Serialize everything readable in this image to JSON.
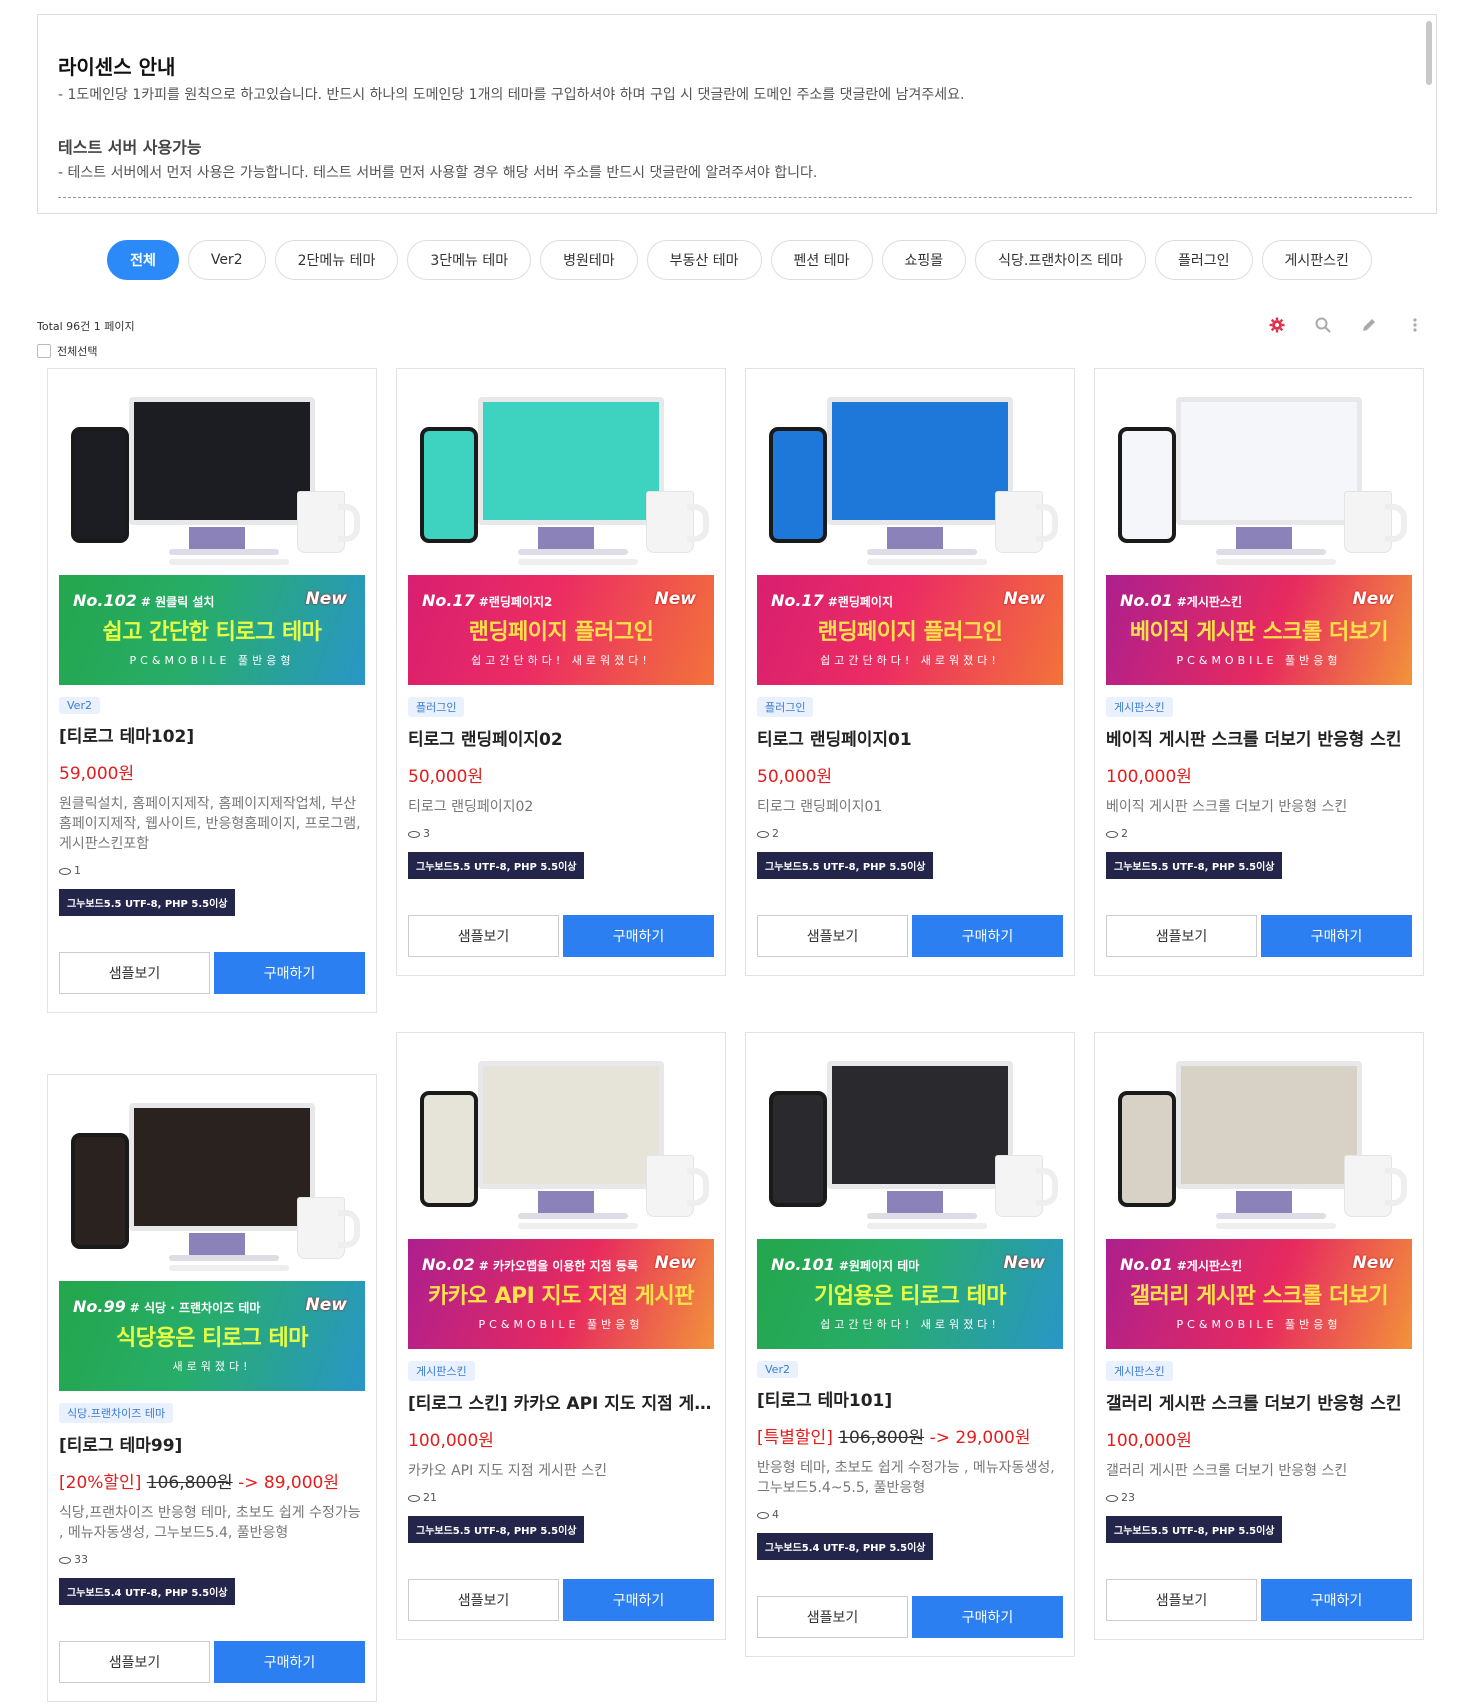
{
  "license": {
    "title": "라이센스 안내",
    "text": "- 1도메인당 1카피를 원칙으로 하고있습니다. 반드시 하나의 도메인당 1개의 테마를 구입하셔야 하며 구입 시 댓글란에 도메인 주소를 댓글란에 남겨주세요.",
    "title2": "테스트 서버 사용가능",
    "text2": "- 테스트 서버에서 먼저 사용은 가능합니다. 테스트 서버를 먼저 사용할 경우 해당 서버 주소를 반드시 댓글란에 알려주셔야 합니다."
  },
  "tabs": [
    "전체",
    "Ver2",
    "2단메뉴 테마",
    "3단메뉴 테마",
    "병원테마",
    "부동산 테마",
    "펜션 테마",
    "쇼핑몰",
    "식당.프랜차이즈 테마",
    "플러그인",
    "게시판스킨"
  ],
  "list": {
    "total": "Total 96건 1 페이지",
    "select_all": "전체선택"
  },
  "colors": {
    "accent": "#2b7ff0",
    "price": "#e21d1d",
    "settings_icon": "#e0324b"
  },
  "buttons": {
    "sample": "샘플보기",
    "buy": "구매하기"
  },
  "products": [
    {
      "banner_no": "No.102",
      "banner_tag": "# 원클릭 설치",
      "banner_title": "쉽고 간단한 티로그 테마",
      "banner_sub": "PC&MOBILE 풀반응형",
      "badge": "Ver2",
      "title": "[티로그 테마102]",
      "price": "59,000원",
      "sale_label": "",
      "old_price": "",
      "new_price": "",
      "desc": "원클릭설치, 홈페이지제작, 홈페이지제작업체, 부산홈페이지제작, 웹사이트, 반응형홈페이지, 프로그램, 게시판스킨포함",
      "views": "1",
      "version": "그누보드5.5 UTF-8, PHP 5.5이상"
    },
    {
      "banner_no": "No.17",
      "banner_tag": "#랜딩페이지2",
      "banner_title": "랜딩페이지 플러그인",
      "banner_sub": "쉽고간단하다! 새로워졌다!",
      "badge": "플러그인",
      "title": "티로그 랜딩페이지02",
      "price": "50,000원",
      "sale_label": "",
      "old_price": "",
      "new_price": "",
      "desc": "티로그 랜딩페이지02",
      "views": "3",
      "version": "그누보드5.5 UTF-8, PHP 5.5이상"
    },
    {
      "banner_no": "No.17",
      "banner_tag": "#랜딩페이지",
      "banner_title": "랜딩페이지 플러그인",
      "banner_sub": "쉽고간단하다! 새로워졌다!",
      "badge": "플러그인",
      "title": "티로그 랜딩페이지01",
      "price": "50,000원",
      "sale_label": "",
      "old_price": "",
      "new_price": "",
      "desc": "티로그 랜딩페이지01",
      "views": "2",
      "version": "그누보드5.5 UTF-8, PHP 5.5이상"
    },
    {
      "banner_no": "No.01",
      "banner_tag": "#게시판스킨",
      "banner_title": "베이직 게시판 스크롤 더보기",
      "banner_sub": "PC&MOBILE 풀반응형",
      "badge": "게시판스킨",
      "title": "베이직 게시판 스크롤 더보기 반응형 스킨",
      "price": "100,000원",
      "sale_label": "",
      "old_price": "",
      "new_price": "",
      "desc": "베이직 게시판 스크롤 더보기 반응형 스킨",
      "views": "2",
      "version": "그누보드5.5 UTF-8, PHP 5.5이상"
    },
    {
      "banner_no": "No.99",
      "banner_tag": "# 식당 · 프랜차이즈 테마",
      "banner_title": "식당용은 티로그 테마",
      "banner_sub": "새로워졌다!",
      "badge": "식당.프랜차이즈 테마",
      "title": "[티로그 테마99]",
      "price": "",
      "sale_label": "[20%할인]",
      "old_price": "106,800원",
      "new_price": "-> 89,000원",
      "desc": "식당,프랜차이즈 반응형 테마, 초보도 쉽게 수정가능 , 메뉴자동생성, 그누보드5.4, 풀반응형",
      "views": "33",
      "version": "그누보드5.4 UTF-8, PHP 5.5이상"
    },
    {
      "banner_no": "No.02",
      "banner_tag": "# 카카오맵을 이용한 지점 등록",
      "banner_title": "카카오 API 지도 지점 게시판",
      "banner_sub": "PC&MOBILE 풀반응형",
      "badge": "게시판스킨",
      "title": "[티로그 스킨] 카카오 API 지도 지점 게시판 스킨",
      "price": "100,000원",
      "sale_label": "",
      "old_price": "",
      "new_price": "",
      "desc": "카카오 API 지도 지점 게시판 스킨",
      "views": "21",
      "version": "그누보드5.5 UTF-8, PHP 5.5이상"
    },
    {
      "banner_no": "No.101",
      "banner_tag": "#원페이지 테마",
      "banner_title": "기업용은 티로그 테마",
      "banner_sub": "쉽고간단하다! 새로워졌다!",
      "badge": "Ver2",
      "title": "[티로그 테마101]",
      "price": "",
      "sale_label": "[특별할인]",
      "old_price": "106,800원",
      "new_price": "-> 29,000원",
      "desc": "반응형 테마, 초보도 쉽게 수정가능 , 메뉴자동생성, 그누보드5.4~5.5, 풀반응형",
      "views": "4",
      "version": "그누보드5.4 UTF-8, PHP 5.5이상"
    },
    {
      "banner_no": "No.01",
      "banner_tag": "#게시판스킨",
      "banner_title": "갤러리 게시판 스크롤 더보기",
      "banner_sub": "PC&MOBILE 풀반응형",
      "badge": "게시판스킨",
      "title": "갤러리 게시판 스크롤 더보기 반응형 스킨",
      "price": "100,000원",
      "sale_label": "",
      "old_price": "",
      "new_price": "",
      "desc": "갤러리 게시판 스크롤 더보기 반응형 스킨",
      "views": "23",
      "version": "그누보드5.5 UTF-8, PHP 5.5이상"
    }
  ],
  "banner_new": "New"
}
